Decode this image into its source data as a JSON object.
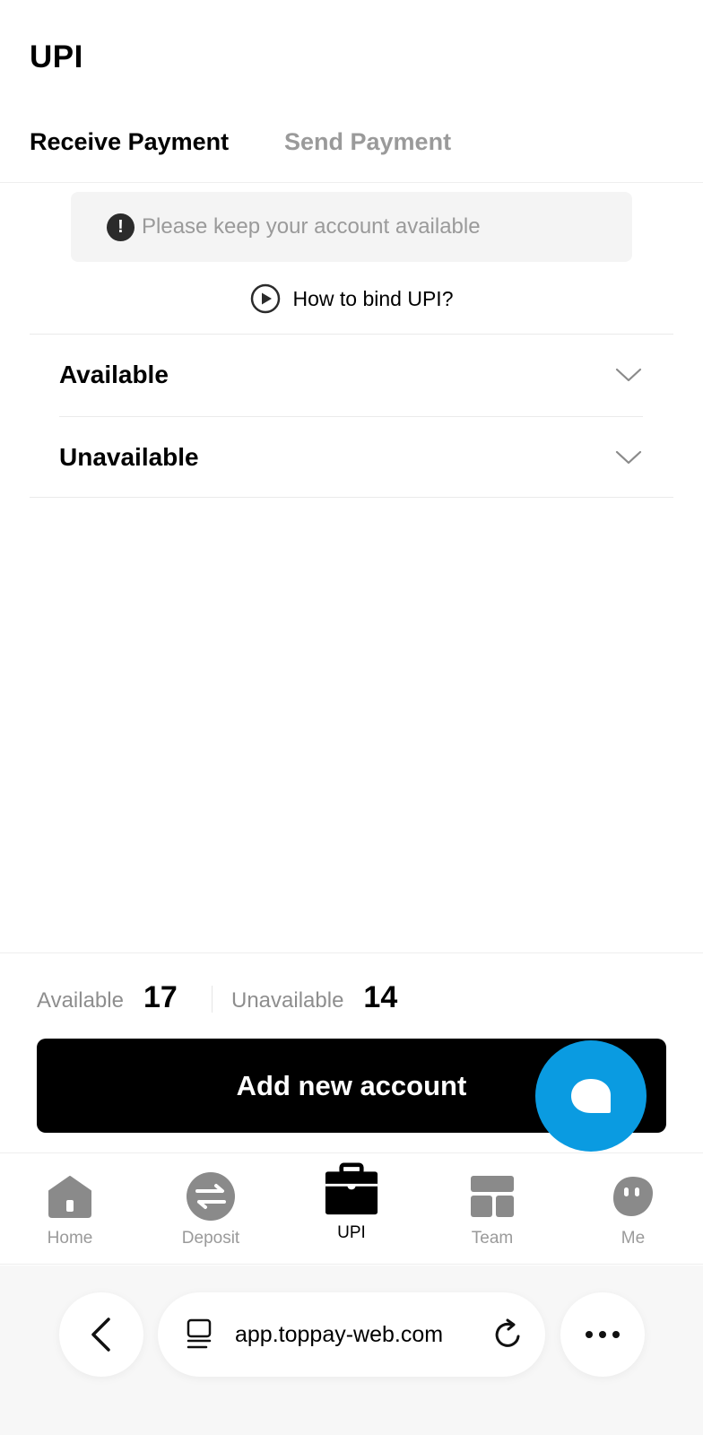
{
  "header": {
    "title": "UPI",
    "tabs": [
      {
        "label": "Receive Payment",
        "active": true
      },
      {
        "label": "Send Payment",
        "active": false
      }
    ]
  },
  "notice": {
    "icon": "exclamation-icon",
    "text": "Please keep your account available"
  },
  "howto": {
    "icon": "play-circle-icon",
    "label": "How to bind UPI?"
  },
  "sections": [
    {
      "label": "Available",
      "icon": "chevron-down-icon"
    },
    {
      "label": "Unavailable",
      "icon": "chevron-down-icon"
    }
  ],
  "summary": {
    "available_label": "Available",
    "available_count": "17",
    "unavailable_label": "Unavailable",
    "unavailable_count": "14"
  },
  "primary_action": {
    "label": "Add new account"
  },
  "chat_fab": {
    "icon": "chat-bubble-icon",
    "color": "#0a9be1"
  },
  "tabbar": {
    "items": [
      {
        "label": "Home",
        "icon": "home-icon",
        "active": false
      },
      {
        "label": "Deposit",
        "icon": "exchange-icon",
        "active": false
      },
      {
        "label": "UPI",
        "icon": "briefcase-icon",
        "active": true
      },
      {
        "label": "Team",
        "icon": "team-grid-icon",
        "active": false
      },
      {
        "label": "Me",
        "icon": "profile-face-icon",
        "active": false
      }
    ]
  },
  "browser": {
    "url": "app.toppay-web.com",
    "back_icon": "back-arrow-icon",
    "page_icon": "page-icon",
    "reload_icon": "reload-icon",
    "more_icon": "more-dots-icon"
  },
  "colors": {
    "accent": "#0a9be1",
    "muted_text": "#9a9a9a",
    "primary_button": "#000000"
  }
}
